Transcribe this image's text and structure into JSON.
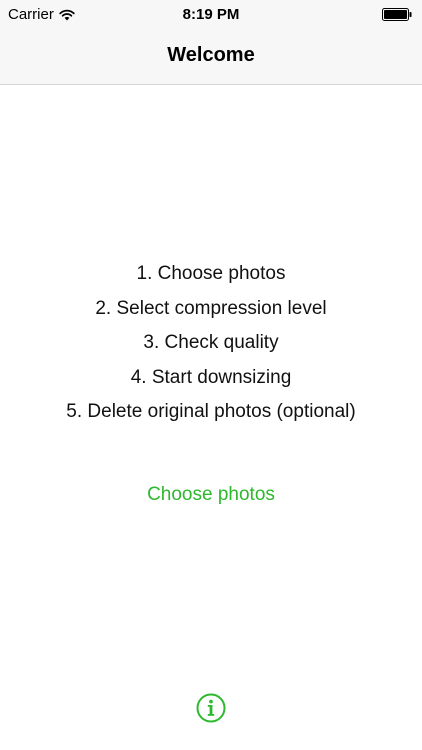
{
  "status_bar": {
    "carrier": "Carrier",
    "time": "8:19 PM"
  },
  "nav": {
    "title": "Welcome"
  },
  "steps": [
    "1. Choose photos",
    "2. Select compression level",
    "3. Check quality",
    "4. Start downsizing",
    "5. Delete original photos (optional)"
  ],
  "cta": {
    "label": "Choose photos"
  },
  "icons": {
    "wifi": "wifi-icon",
    "battery": "battery-icon",
    "info": "info-icon"
  },
  "colors": {
    "accent": "#2eb82e",
    "nav_background": "#f7f7f7",
    "text": "#111111"
  }
}
